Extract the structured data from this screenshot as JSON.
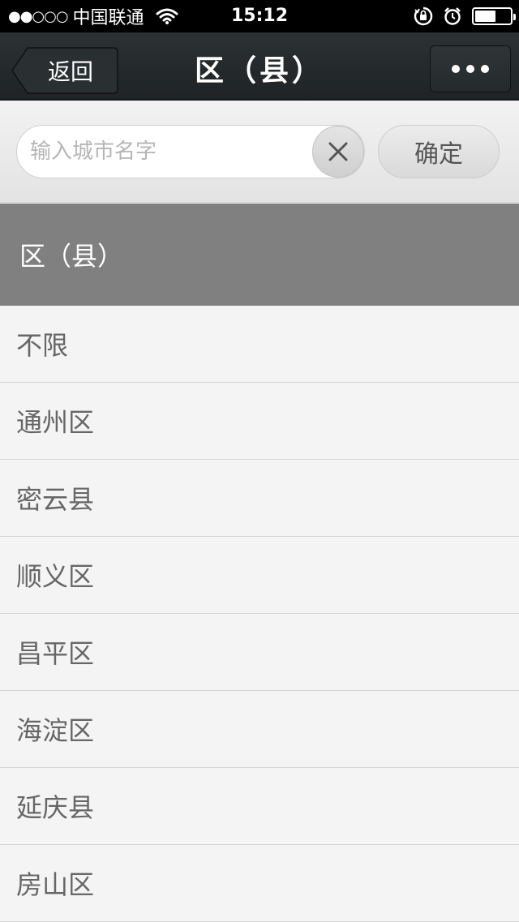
{
  "status_bar": {
    "signal": "●●○○○",
    "carrier": "中国联通",
    "time": "15:12",
    "battery_level": 0.6,
    "icons": [
      "wifi-icon",
      "rotation-lock-icon",
      "alarm-icon",
      "battery-icon"
    ]
  },
  "nav": {
    "back_label": "返回",
    "title": "区（县）",
    "more_icon": "more-dots-icon"
  },
  "search": {
    "placeholder": "输入城市名字",
    "value": "",
    "clear_icon": "close-icon",
    "confirm_label": "确定"
  },
  "section": {
    "header": "区（县）"
  },
  "districts": [
    "不限",
    "通州区",
    "密云县",
    "顺义区",
    "昌平区",
    "海淀区",
    "延庆县",
    "房山区"
  ],
  "colors": {
    "status_bar_bg": "#000000",
    "nav_bg": "#2c3133",
    "section_header_bg": "#808080",
    "list_bg": "#f4f4f4",
    "list_text": "#666666"
  }
}
